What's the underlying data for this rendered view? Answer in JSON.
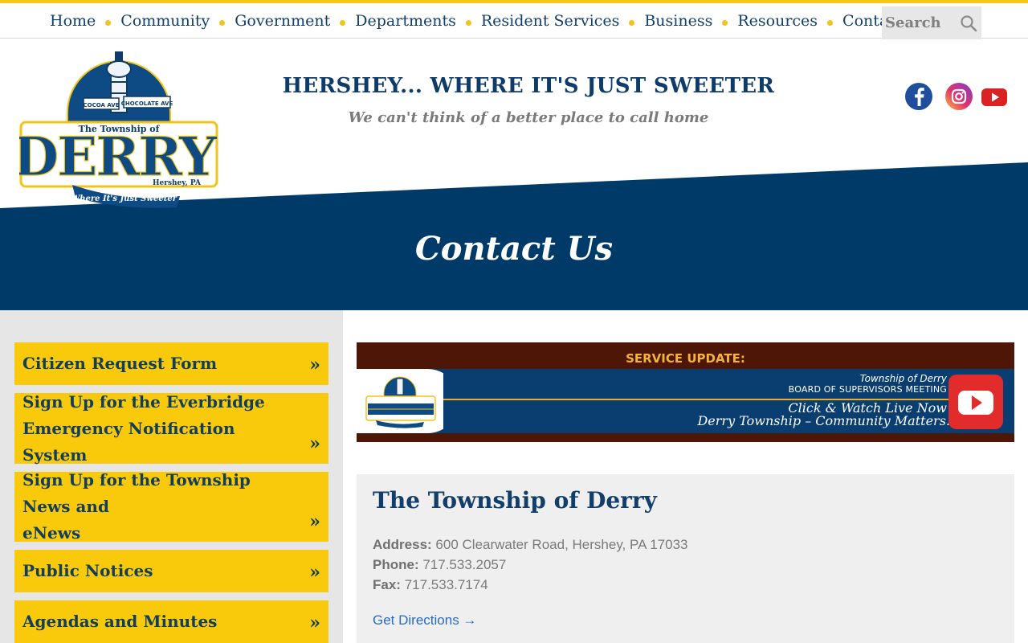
{
  "nav": {
    "items": [
      "Home",
      "Community",
      "Government",
      "Departments",
      "Resident Services",
      "Business",
      "Resources",
      "Contact Us"
    ],
    "search_placeholder": "Search"
  },
  "header": {
    "logo_texts": {
      "sign_left": "COCOA AVE",
      "sign_right": "CHOCOLATE AVE",
      "township_of": "The Township of",
      "name": "DERRY",
      "location": "Hershey, PA",
      "motto": "Where It's Just Sweeter"
    },
    "tagline": "HERSHEY... WHERE IT'S JUST SWEETER",
    "subtagline": "We can't think of a better place to call home",
    "social": [
      "facebook-icon",
      "instagram-icon",
      "youtube-icon"
    ]
  },
  "banner": {
    "title": "Contact Us"
  },
  "sidebar": {
    "items": [
      {
        "line1": "Citizen Request Form",
        "line2": ""
      },
      {
        "line1": "Sign Up for the Everbridge",
        "line2": "Emergency Notification System"
      },
      {
        "line1": "Sign Up for the Township News and",
        "line2": "eNews"
      },
      {
        "line1": "Public Notices",
        "line2": ""
      },
      {
        "line1": "Agendas and Minutes",
        "line2": ""
      }
    ],
    "chevron": "»"
  },
  "service_update": {
    "label": "SERVICE UPDATE:",
    "small1": "Township of Derry",
    "small2": "BOARD OF SUPERVISORS MEETING",
    "big1": "Click & Watch Live Now",
    "big2": "Derry Township – Community Matters."
  },
  "info": {
    "title": "The Township of Derry",
    "address_label": "Address:",
    "address": "600 Clearwater Road, Hershey, PA 17033",
    "phone_label": "Phone:",
    "phone": "717.533.2057",
    "fax_label": "Fax:",
    "fax": "717.533.7174",
    "directions": "Get Directions →"
  },
  "colors": {
    "navy": "#0b3a66",
    "gold": "#f9ca0b",
    "maroon": "#4d1606",
    "link": "#2a6ac1"
  }
}
